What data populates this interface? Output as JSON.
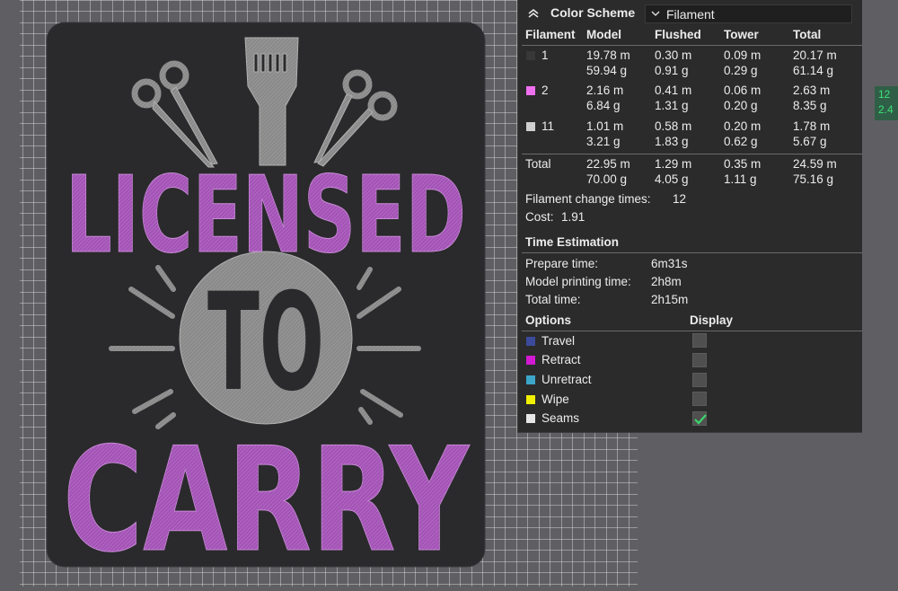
{
  "header": {
    "title": "Color Scheme",
    "scheme_value": "Filament"
  },
  "table": {
    "columns": [
      "Filament",
      "Model",
      "Flushed",
      "Tower",
      "Total"
    ],
    "rows": [
      {
        "id": "1",
        "color": "#2c2c2c",
        "model": [
          "19.78 m",
          "59.94 g"
        ],
        "flushed": [
          "0.30 m",
          "0.91 g"
        ],
        "tower": [
          "0.09 m",
          "0.29 g"
        ],
        "total": [
          "20.17 m",
          "61.14 g"
        ]
      },
      {
        "id": "2",
        "color": "#ee70ee",
        "model": [
          "2.16 m",
          "6.84 g"
        ],
        "flushed": [
          "0.41 m",
          "1.31 g"
        ],
        "tower": [
          "0.06 m",
          "0.20 g"
        ],
        "total": [
          "2.63 m",
          "8.35 g"
        ]
      },
      {
        "id": "11",
        "color": "#cfcfcf",
        "model": [
          "1.01 m",
          "3.21 g"
        ],
        "flushed": [
          "0.58 m",
          "1.83 g"
        ],
        "tower": [
          "0.20 m",
          "0.62 g"
        ],
        "total": [
          "1.78 m",
          "5.67 g"
        ]
      }
    ],
    "total_row": {
      "label": "Total",
      "model": [
        "22.95 m",
        "70.00 g"
      ],
      "flushed": [
        "1.29 m",
        "4.05 g"
      ],
      "tower": [
        "0.35 m",
        "1.11 g"
      ],
      "total": [
        "24.59 m",
        "75.16 g"
      ]
    }
  },
  "filament_change": {
    "label": "Filament change times:",
    "value": "12"
  },
  "cost": {
    "label": "Cost:",
    "value": "1.91"
  },
  "time_estimation": {
    "title": "Time Estimation",
    "items": [
      {
        "label": "Prepare time:",
        "value": "6m31s"
      },
      {
        "label": "Model printing time:",
        "value": "2h8m"
      },
      {
        "label": "Total time:",
        "value": "2h15m"
      }
    ]
  },
  "options": {
    "title": "Options",
    "display_title": "Display",
    "items": [
      {
        "label": "Travel",
        "color": "#3b4a9a",
        "checked": false
      },
      {
        "label": "Retract",
        "color": "#d21ad2",
        "checked": false
      },
      {
        "label": "Unretract",
        "color": "#3ca6c8",
        "checked": false
      },
      {
        "label": "Wipe",
        "color": "#f0f000",
        "checked": false
      },
      {
        "label": "Seams",
        "color": "#e6e6e6",
        "checked": true
      }
    ]
  },
  "model": {
    "line1": "LICENSED",
    "line2": "TO",
    "line3": "CARRY"
  },
  "side_badge": {
    "line1": "12",
    "line2": "2.4"
  },
  "colors": {
    "accent_purple": "#a655b8",
    "plate": "#2a2a2c",
    "model_gray": "#8a8a8a",
    "check_green": "#3ad56a"
  }
}
